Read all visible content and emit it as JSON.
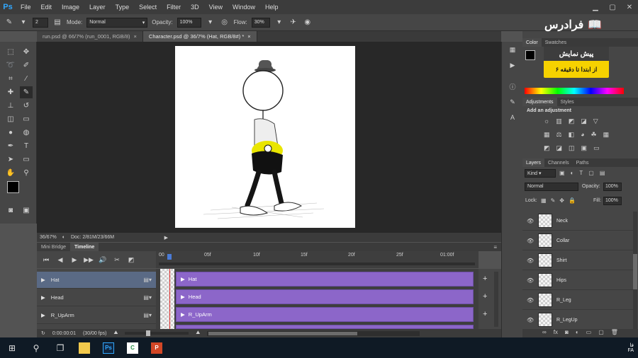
{
  "app": {
    "logo": "Ps"
  },
  "menu": [
    "File",
    "Edit",
    "Image",
    "Layer",
    "Type",
    "Select",
    "Filter",
    "3D",
    "View",
    "Window",
    "Help"
  ],
  "window_controls": [
    "minimize-icon",
    "maximize-icon",
    "close-icon"
  ],
  "options_bar": {
    "brush_size": "2",
    "mode_label": "Mode:",
    "mode_value": "Normal",
    "opacity_label": "Opacity:",
    "opacity_value": "100%",
    "flow_label": "Flow:",
    "flow_value": "30%"
  },
  "document_tabs": [
    {
      "label": "run.psd @ 66/7% (run_0001, RGB/8)",
      "close": "×",
      "active": false
    },
    {
      "label": "Character.psd @ 36/7% (Hat, RGB/8#) *",
      "close": "×",
      "active": true
    }
  ],
  "status": {
    "zoom": "36/67%",
    "doc": "Doc: 2/81M/23/66M"
  },
  "timeline": {
    "tabs": [
      "Mini Bridge",
      "Timeline"
    ],
    "active_tab": "Timeline",
    "ruler_ticks": [
      "00",
      "05f",
      "10f",
      "15f",
      "20f",
      "25f",
      "01:00f"
    ],
    "layers": [
      "Hat",
      "Head",
      "R_UpArm"
    ],
    "selected_layer": "Hat",
    "tracks": [
      "Hat",
      "Head",
      "R_UpArm"
    ],
    "timecode": "0:00:00:01",
    "fps": "(30/00 fps)"
  },
  "color_panel": {
    "tabs": [
      "Color",
      "Swatches"
    ]
  },
  "adjustments_panel": {
    "tabs": [
      "Adjustments",
      "Styles"
    ],
    "add_label": "Add an adjustment"
  },
  "layers_panel": {
    "tabs": [
      "Layers",
      "Channels",
      "Paths"
    ],
    "kind_label": "Kind",
    "blend_mode": "Normal",
    "opacity_label": "Opacity:",
    "opacity_value": "100%",
    "lock_label": "Lock:",
    "fill_label": "Fill:",
    "fill_value": "100%",
    "layers": [
      "Neck",
      "Collar",
      "Shirt",
      "Hips",
      "R_Leg",
      "R_LegUp"
    ]
  },
  "watermark": {
    "brand": "فرادرس",
    "preview_title": "پیش نمایش",
    "preview_sub": "از ابتدا تا دقیقه ۶"
  },
  "taskbar": {
    "apps": [
      "Ps",
      "C",
      "P"
    ],
    "tray_lang": "FA",
    "tray_top": "فا"
  }
}
